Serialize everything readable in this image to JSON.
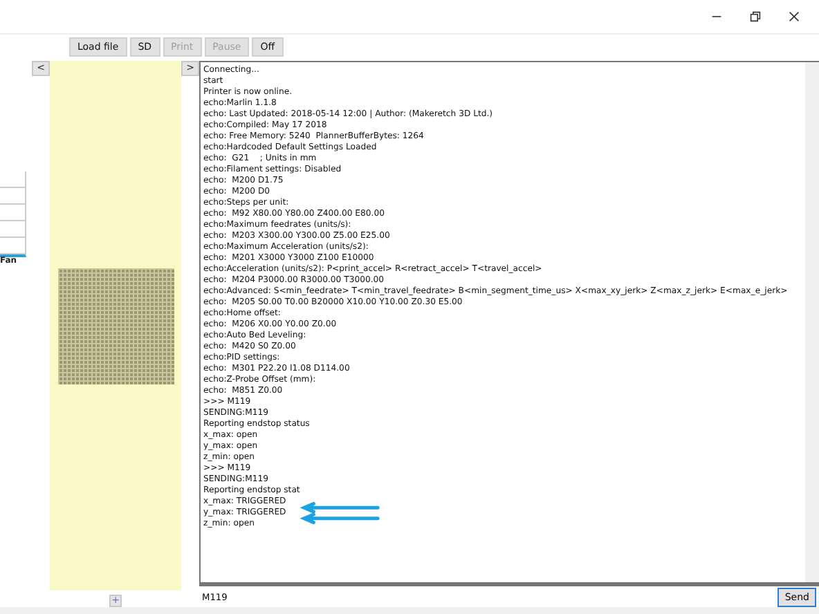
{
  "toolbar": [
    {
      "label": "Load file",
      "disabled": false
    },
    {
      "label": "SD",
      "disabled": false
    },
    {
      "label": "Print",
      "disabled": true
    },
    {
      "label": "Pause",
      "disabled": true
    },
    {
      "label": "Off",
      "disabled": false
    }
  ],
  "left_panel": {
    "collapse_button": "<",
    "graph_label": "Fan",
    "add_button": "+"
  },
  "expand_button": ">",
  "console": {
    "lines": [
      "Connecting...",
      "start",
      "Printer is now online.",
      "echo:Marlin 1.1.8",
      "echo: Last Updated: 2018-05-14 12:00 | Author: (Makeretch 3D Ltd.)",
      "echo:Compiled: May 17 2018",
      "echo: Free Memory: 5240  PlannerBufferBytes: 1264",
      "echo:Hardcoded Default Settings Loaded",
      "echo:  G21    ; Units in mm",
      "echo:Filament settings: Disabled",
      "echo:  M200 D1.75",
      "echo:  M200 D0",
      "echo:Steps per unit:",
      "echo:  M92 X80.00 Y80.00 Z400.00 E80.00",
      "echo:Maximum feedrates (units/s):",
      "echo:  M203 X300.00 Y300.00 Z5.00 E25.00",
      "echo:Maximum Acceleration (units/s2):",
      "echo:  M201 X3000 Y3000 Z100 E10000",
      "echo:Acceleration (units/s2): P<print_accel> R<retract_accel> T<travel_accel>",
      "echo:  M204 P3000.00 R3000.00 T3000.00",
      "echo:Advanced: S<min_feedrate> T<min_travel_feedrate> B<min_segment_time_us> X<max_xy_jerk> Z<max_z_jerk> E<max_e_jerk>",
      "echo:  M205 S0.00 T0.00 B20000 X10.00 Y10.00 Z0.30 E5.00",
      "echo:Home offset:",
      "echo:  M206 X0.00 Y0.00 Z0.00",
      "echo:Auto Bed Leveling:",
      "echo:  M420 S0 Z0.00",
      "echo:PID settings:",
      "echo:  M301 P22.20 I1.08 D114.00",
      "echo:Z-Probe Offset (mm):",
      "echo:  M851 Z0.00",
      ">>> M119",
      "SENDING:M119",
      "Reporting endstop status",
      "x_max: open",
      "y_max: open",
      "z_min: open",
      ">>> M119",
      "SENDING:M119",
      "Reporting endstop stat",
      "x_max: TRIGGERED",
      "y_max: TRIGGERED",
      "z_min: open"
    ],
    "command_value": "M119",
    "send_button": "Send"
  }
}
